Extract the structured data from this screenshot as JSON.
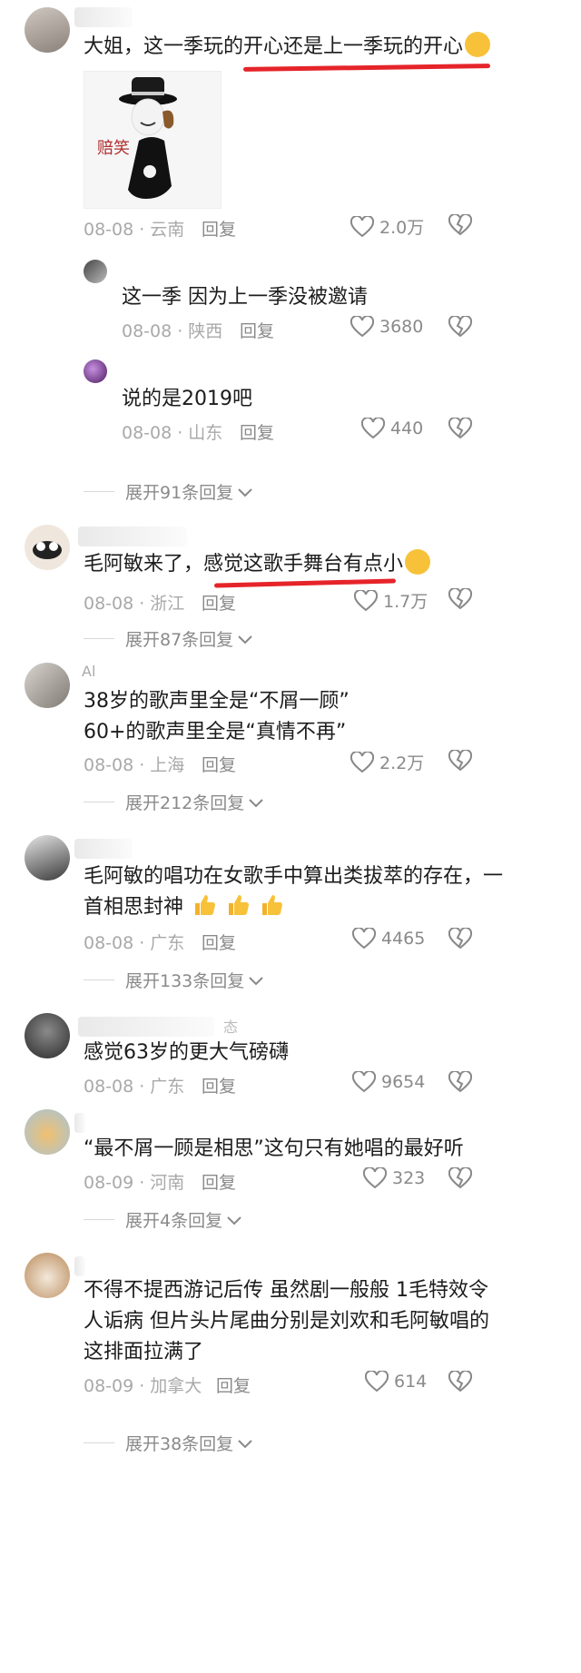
{
  "c1": {
    "text": "大姐，这一季玩的开心还是上一季玩的开心",
    "sticker_label": "赔笑",
    "date": "08-08",
    "loc": "云南",
    "reply": "回复",
    "likes": "2.0万"
  },
  "r1": {
    "text": "这一季 因为上一季没被邀请",
    "date": "08-08",
    "loc": "陕西",
    "reply": "回复",
    "likes": "3680"
  },
  "r2": {
    "text": "说的是2019吧",
    "date": "08-08",
    "loc": "山东",
    "reply": "回复",
    "likes": "440"
  },
  "expand1": "展开91条回复",
  "c2": {
    "text": "毛阿敏来了，感觉这歌手舞台有点小",
    "date": "08-08",
    "loc": "浙江",
    "reply": "回复",
    "likes": "1.7万"
  },
  "expand2": "展开87条回复",
  "c3": {
    "name": "Al",
    "line1": "38岁的歌声里全是“不屑一顾”",
    "line2": "60+的歌声里全是“真情不再”",
    "date": "08-08",
    "loc": "上海",
    "reply": "回复",
    "likes": "2.2万"
  },
  "expand3": "展开212条回复",
  "c4": {
    "line1": "毛阿敏的唱功在女歌手中算出类拔萃的存在，一",
    "line2": "首相思封神",
    "date": "08-08",
    "loc": "广东",
    "reply": "回复",
    "likes": "4465"
  },
  "expand4": "展开133条回复",
  "c5": {
    "name_suffix": "态",
    "text": "感觉63岁的更大气磅礴",
    "date": "08-08",
    "loc": "广东",
    "reply": "回复",
    "likes": "9654"
  },
  "c6": {
    "text": "“最不屑一顾是相思”这句只有她唱的最好听",
    "date": "08-09",
    "loc": "河南",
    "reply": "回复",
    "likes": "323"
  },
  "expand6": "展开4条回复",
  "c7": {
    "line1": "不得不提西游记后传 虽然剧一般般  1毛特效令",
    "line2": "人诟病 但片头片尾曲分别是刘欢和毛阿敏唱的",
    "line3": "这排面拉满了",
    "date": "08-09",
    "loc": "加拿大",
    "reply": "回复",
    "likes": "614"
  },
  "expand7": "展开38条回复",
  "colors": {
    "accent_underline": "#e5242a",
    "meta_gray": "#a9a9a9",
    "emoji_yellow": "#f7c23a"
  },
  "icons": [
    "heart-outline-icon",
    "broken-heart-icon",
    "chevron-down-icon",
    "laughing-crying-emoji",
    "thumbs-up-emoji"
  ]
}
